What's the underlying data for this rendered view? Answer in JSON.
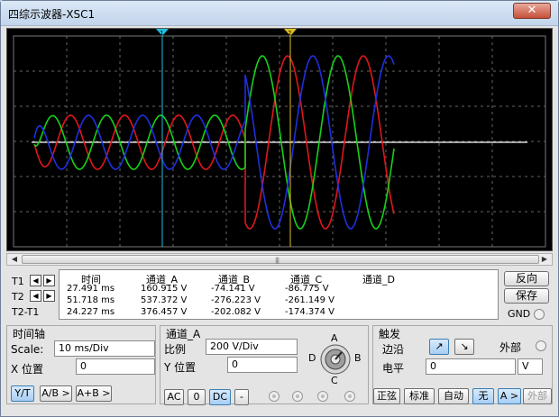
{
  "window": {
    "title": "四综示波器-XSC1",
    "close_glyph": "✕"
  },
  "trace_colors": {
    "a": "#e0161b",
    "b": "#17d11a",
    "c": "#1f2fe0",
    "ground": "#ffffff",
    "t1": "#20c0e0",
    "t2": "#e0c020"
  },
  "cursors": {
    "t1_label": "T1",
    "t2_label": "T2",
    "diff_label": "T2-T1",
    "left_arrow": "◀",
    "right_arrow": "▶",
    "t1_marker": "1",
    "t2_marker": "2"
  },
  "measurements": {
    "headers": [
      "时间",
      "通道_A",
      "通道_B",
      "通道_C",
      "通道_D"
    ],
    "rows": [
      [
        "27.491 ms",
        "160.915 V",
        "-74.141 V",
        "-86.775 V",
        ""
      ],
      [
        "51.718 ms",
        "537.372 V",
        "-276.223 V",
        "-261.149 V",
        ""
      ],
      [
        "24.227 ms",
        "376.457 V",
        "-202.082 V",
        "-174.374 V",
        ""
      ]
    ]
  },
  "side": {
    "reverse": "反向",
    "save": "保存",
    "gnd": "GND"
  },
  "timebase": {
    "title": "时间轴",
    "scale_label": "Scale:",
    "scale_value": "10 ms/Div",
    "xpos_label": "X 位置",
    "xpos_value": "0",
    "modes": [
      "Y/T",
      "A/B >",
      "A+B >"
    ],
    "active_mode": "Y/T"
  },
  "channel_a": {
    "title": "通道_A",
    "ratio_label": "比例",
    "ratio_value": "200  V/Div",
    "ypos_label": "Y 位置",
    "ypos_value": "0",
    "couplings": [
      "AC",
      "0",
      "DC",
      "-"
    ],
    "active_coupling": "DC",
    "knob_labels": {
      "a": "A",
      "b": "B",
      "c": "C",
      "d": "D"
    }
  },
  "trigger": {
    "title": "触发",
    "edge_label": "边沿",
    "external_label": "外部",
    "level_label": "电平",
    "level_value": "0",
    "level_unit": "V",
    "edge_rise": "↗",
    "edge_fall": "↘",
    "modes": [
      "正弦",
      "标准",
      "自动",
      "无",
      "A >",
      "外部"
    ],
    "active_mode": "无"
  },
  "scrollbar": {
    "left": "◀",
    "right": "▶",
    "grip": "|||"
  }
}
